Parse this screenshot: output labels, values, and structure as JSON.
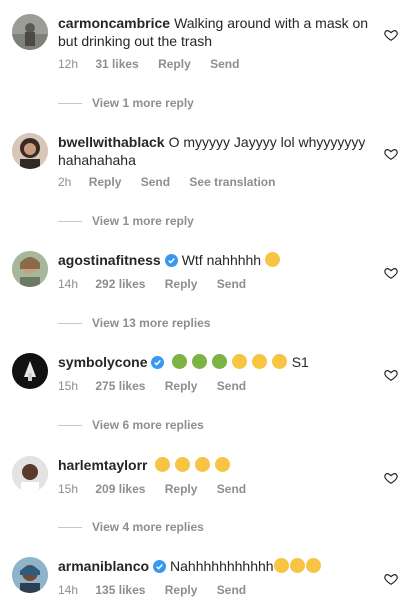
{
  "comments": [
    {
      "username": "carmoncambrice",
      "text": "Walking around with a mask on but drinking out the trash",
      "verified": false,
      "emojis": [],
      "time": "12h",
      "likes": "31 likes",
      "reply": "Reply",
      "send": "Send",
      "extra": "",
      "replies": "View 1 more reply"
    },
    {
      "username": "bwellwithablack",
      "text": "O myyyyy Jayyyy lol whyyyyyyy hahahahaha",
      "verified": false,
      "emojis": [],
      "time": "2h",
      "likes": "",
      "reply": "Reply",
      "send": "Send",
      "extra": "See translation",
      "replies": "View 1 more reply"
    },
    {
      "username": "agostinafitness",
      "text": "Wtf nahhhhh",
      "verified": true,
      "emojis": [
        "laugh"
      ],
      "time": "14h",
      "likes": "292 likes",
      "reply": "Reply",
      "send": "Send",
      "extra": "",
      "replies": "View 13 more replies"
    },
    {
      "username": "symbolycone",
      "text": "",
      "verified": true,
      "emojis": [
        "sick",
        "sick",
        "sick",
        "laugh",
        "laugh",
        "laugh"
      ],
      "after_text": "S1",
      "time": "15h",
      "likes": "275 likes",
      "reply": "Reply",
      "send": "Send",
      "extra": "",
      "replies": "View 6 more replies"
    },
    {
      "username": "harlemtaylorr",
      "text": "",
      "verified": false,
      "emojis": [
        "cry",
        "cry",
        "cry",
        "cry"
      ],
      "time": "15h",
      "likes": "209 likes",
      "reply": "Reply",
      "send": "Send",
      "extra": "",
      "replies": "View 4 more replies"
    },
    {
      "username": "armaniblanco",
      "text": "Nahhhhhhhhhhh",
      "verified": true,
      "emojis": [
        "laugh",
        "laugh",
        "laugh"
      ],
      "time": "14h",
      "likes": "135 likes",
      "reply": "Reply",
      "send": "Send",
      "extra": "",
      "replies": ""
    }
  ],
  "colors": {
    "text": "#262626",
    "muted": "#8e8e8e",
    "verified": "#3897f0",
    "laugh_emoji": "#f7c443",
    "sick_emoji": "#7cb342"
  }
}
